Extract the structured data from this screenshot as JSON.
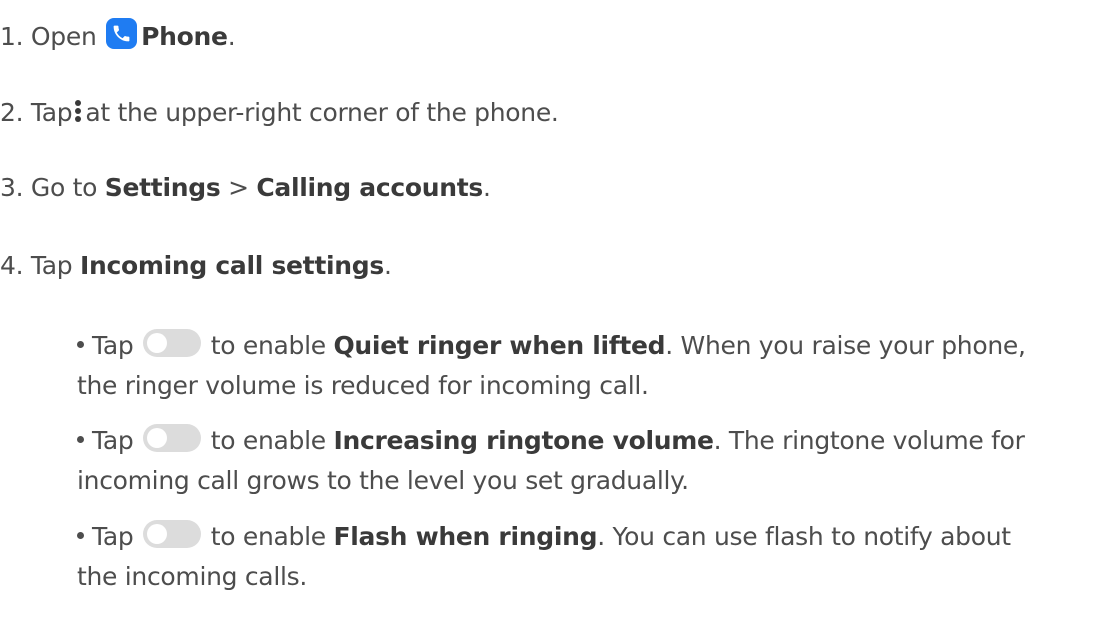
{
  "steps": [
    {
      "number": "1.",
      "pre": "Open",
      "bold": "Phone",
      "post": "."
    },
    {
      "number": "2.",
      "pre": "Tap",
      "post": "at the upper-right corner of the phone."
    },
    {
      "number": "3.",
      "pre": "Go to",
      "bold1": "Settings",
      "sep": ">",
      "bold2": "Calling accounts",
      "post": "."
    },
    {
      "number": "4.",
      "pre": "Tap",
      "bold": "Incoming call settings",
      "post": "."
    }
  ],
  "bullets": [
    {
      "pre": "Tap",
      "mid": "to enable",
      "bold": "Quiet ringer when lifted",
      "post": ". When you raise your phone,",
      "line2": "the ringer volume is reduced for incoming call."
    },
    {
      "pre": "Tap",
      "mid": "to enable",
      "bold": "Increasing ringtone volume",
      "post": ". The ringtone volume for",
      "line2": "incoming call grows to the level you set gradually."
    },
    {
      "pre": "Tap",
      "mid": "to enable",
      "bold": "Flash when ringing",
      "post": ". You can use flash to notify about",
      "line2": "the incoming calls."
    }
  ],
  "colors": {
    "text": "#4d4d4d",
    "bold_text": "#3a3a3a",
    "phone_icon_bg": "#1f7cf2",
    "toggle_off": "#dcdcdc"
  },
  "icons": {
    "phone": "phone-app-icon",
    "more": "more-vertical-icon",
    "toggle": "toggle-off-icon"
  }
}
